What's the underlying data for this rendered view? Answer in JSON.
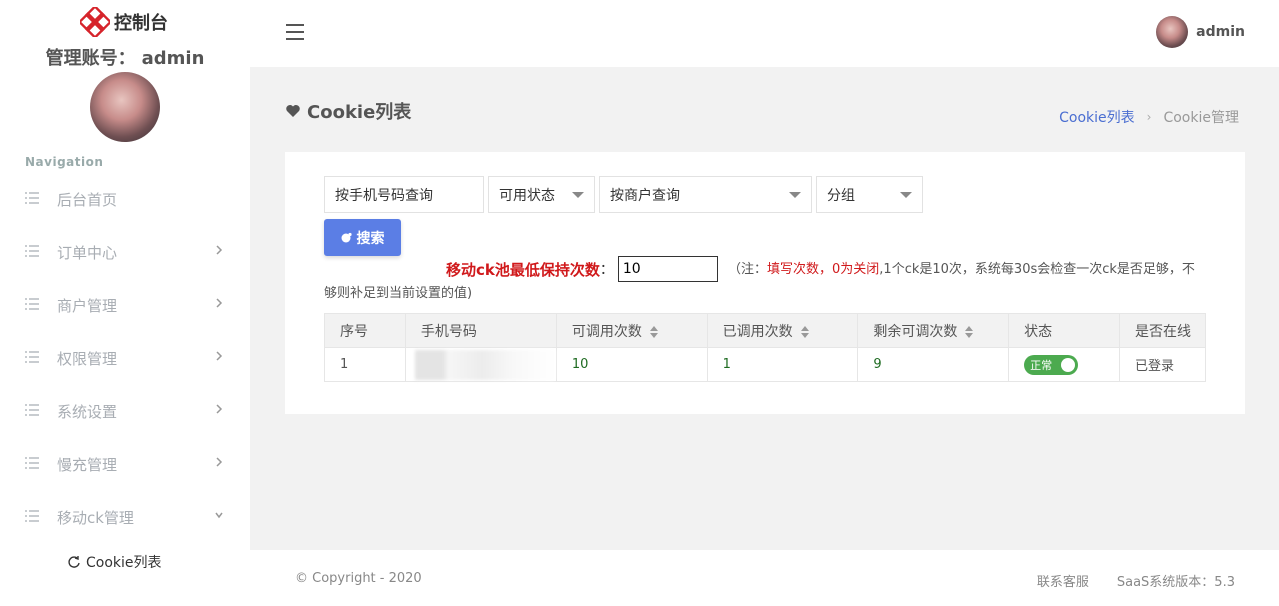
{
  "brand": {
    "title": "控制台"
  },
  "account": {
    "label": "管理账号：",
    "name": "admin"
  },
  "nav": {
    "heading": "Navigation",
    "items": [
      {
        "label": "后台首页",
        "has_children": false
      },
      {
        "label": "订单中心",
        "has_children": true
      },
      {
        "label": "商户管理",
        "has_children": true
      },
      {
        "label": "权限管理",
        "has_children": true
      },
      {
        "label": "系统设置",
        "has_children": true
      },
      {
        "label": "慢充管理",
        "has_children": true
      },
      {
        "label": "移动ck管理",
        "has_children": true,
        "expanded": true
      }
    ],
    "sub_items": [
      {
        "label": "Cookie列表"
      }
    ]
  },
  "header": {
    "user_name": "admin"
  },
  "page": {
    "title": "Cookie列表"
  },
  "breadcrumb": {
    "link": "Cookie列表",
    "current": "Cookie管理"
  },
  "filters": {
    "phone_placeholder": "按手机号码查询",
    "status_select": "可用状态",
    "merchant_select": "按商户查询",
    "group_select": "分组",
    "search_label": "搜索"
  },
  "pool": {
    "label": "移动ck池最低保持次数",
    "colon": "：",
    "value": "10",
    "note_prefix": "（注：",
    "note_red": "填写次数，0为关闭",
    "note_rest": ",1个ck是10次，系统每30s会检查一次ck是否足够，不够则补足到当前设置的值)"
  },
  "table": {
    "headers": [
      "序号",
      "手机号码",
      "可调用次数",
      "已调用次数",
      "剩余可调次数",
      "状态",
      "是否在线"
    ],
    "rows": [
      {
        "index": "1",
        "phone": "133",
        "callable": "10",
        "called": "1",
        "remaining": "9",
        "status": "正常",
        "online": "已登录"
      }
    ]
  },
  "footer": {
    "copyright": "© Copyright - 2020",
    "support": "联系客服",
    "version": "SaaS系统版本：5.3"
  },
  "colors": {
    "accent": "#5b7ee5",
    "danger": "#d0191b",
    "success": "#4caa4f",
    "brand_logo": "#d6242b"
  }
}
